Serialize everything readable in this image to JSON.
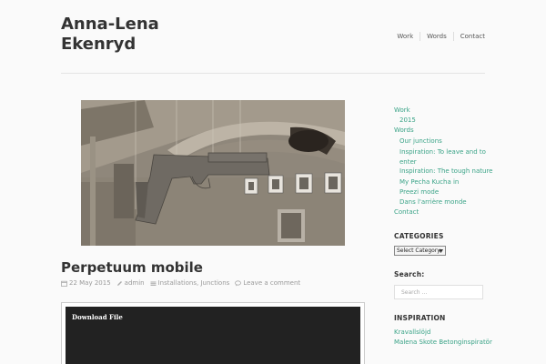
{
  "site": {
    "title_line1": "Anna-Lena",
    "title_line2": "Ekenryd"
  },
  "nav": {
    "items": [
      {
        "label": "Work"
      },
      {
        "label": "Words"
      },
      {
        "label": "Contact"
      }
    ]
  },
  "post": {
    "title": "Perpetuum mobile",
    "date": "22 May 2015",
    "author": "admin",
    "categories": "Installations, Junctions",
    "comments": "Leave a comment",
    "download_label": "Download File"
  },
  "sidebar": {
    "pages": [
      {
        "label": "Work",
        "level": 0
      },
      {
        "label": "2015",
        "level": 1
      },
      {
        "label": "Words",
        "level": 0
      },
      {
        "label": "Our junctions",
        "level": 1
      },
      {
        "label": "Inspiration: To leave and to enter",
        "level": 1
      },
      {
        "label": "Inspiration: The tough nature",
        "level": 1
      },
      {
        "label": "My Pecha Kucha in Preezi mode",
        "level": 1
      },
      {
        "label": "Dans l'arrière monde",
        "level": 1
      },
      {
        "label": "Contact",
        "level": 0
      }
    ],
    "categories_heading": "CATEGORIES",
    "categories_select": "Select Category",
    "search_heading": "Search:",
    "search_placeholder": "Search ...",
    "inspiration_heading": "INSPIRATION",
    "inspiration_links": [
      {
        "label": "Kravallslöjd"
      },
      {
        "label": "Malena Skote Betonginspiratör"
      }
    ]
  },
  "colors": {
    "accent": "#3aa387",
    "text": "#333333",
    "muted": "#999999",
    "download_bg": "#222222"
  }
}
